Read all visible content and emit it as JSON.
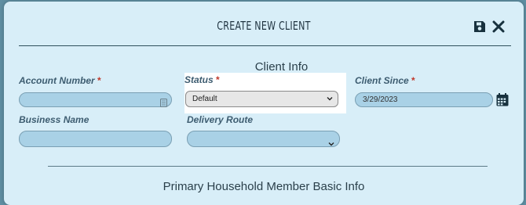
{
  "modal": {
    "title": "CREATE NEW CLIENT"
  },
  "sections": {
    "client_info": "Client Info",
    "primary_household": "Primary Household Member Basic Info"
  },
  "fields": {
    "account_number": {
      "label": "Account Number",
      "required_mark": "*",
      "value": ""
    },
    "status": {
      "label": "Status",
      "required_mark": "*",
      "selected": "Default"
    },
    "client_since": {
      "label": "Client Since",
      "required_mark": "*",
      "value": "3/29/2023"
    },
    "business_name": {
      "label": "Business Name",
      "value": ""
    },
    "delivery_route": {
      "label": "Delivery Route",
      "selected": ""
    }
  },
  "icons": {
    "save": "save-icon",
    "close": "close-icon",
    "calendar": "calendar-icon",
    "field_list": "field-list-icon",
    "chevron": "chevron-down-icon"
  },
  "colors": {
    "modal_bg": "#d8eef8",
    "field_bg": "#a9d1e6",
    "label": "#3d5c70",
    "required": "#c0392b"
  }
}
